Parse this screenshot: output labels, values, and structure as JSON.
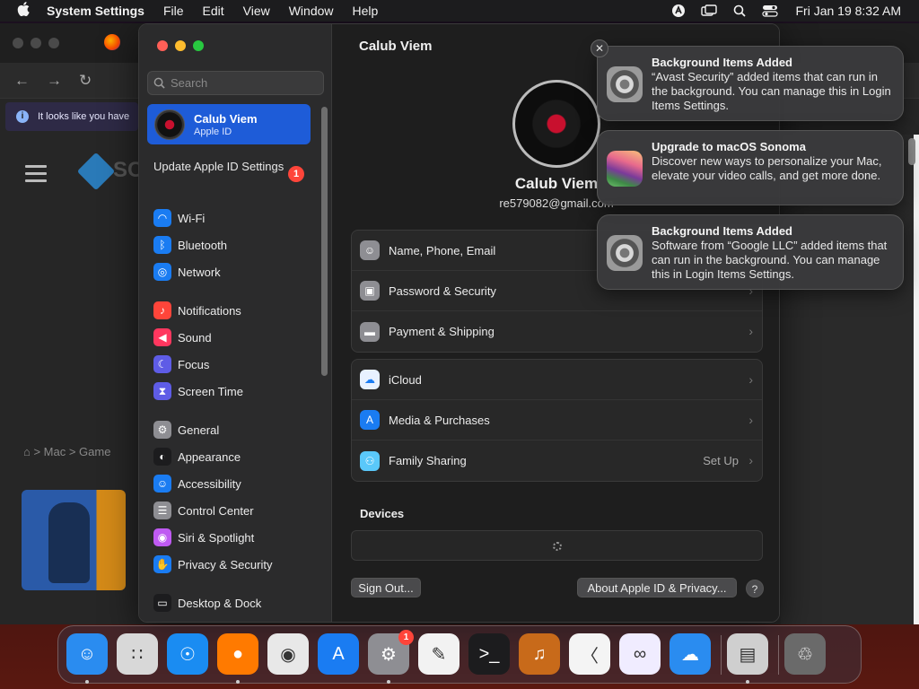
{
  "menubar": {
    "app_name": "System Settings",
    "items": [
      "File",
      "Edit",
      "View",
      "Window",
      "Help"
    ],
    "status_icons": [
      "avast-icon",
      "display-mirror-icon",
      "spotlight-search-icon",
      "control-center-icon"
    ],
    "clock": "Fri Jan 19  8:32 AM"
  },
  "browser": {
    "info_text": "It looks like you have",
    "logo_text": "SC",
    "breadcrumb": "⌂ > Mac > Game"
  },
  "settings": {
    "search": {
      "placeholder": "Search"
    },
    "account": {
      "name": "Calub Viem",
      "subtitle": "Apple ID"
    },
    "update": {
      "label": "Update Apple ID Settings",
      "badge": "1"
    },
    "sidebar_groups": [
      [
        {
          "label": "Wi-Fi",
          "icon": "wifi-icon",
          "color": "#1a7cf2"
        },
        {
          "label": "Bluetooth",
          "icon": "bluetooth-icon",
          "color": "#1a7cf2"
        },
        {
          "label": "Network",
          "icon": "globe-icon",
          "color": "#1a7cf2"
        }
      ],
      [
        {
          "label": "Notifications",
          "icon": "bell-icon",
          "color": "#ff453a"
        },
        {
          "label": "Sound",
          "icon": "speaker-icon",
          "color": "#ff375f"
        },
        {
          "label": "Focus",
          "icon": "moon-icon",
          "color": "#5e5ce6"
        },
        {
          "label": "Screen Time",
          "icon": "hourglass-icon",
          "color": "#5e5ce6"
        }
      ],
      [
        {
          "label": "General",
          "icon": "gear-icon",
          "color": "#8e8e93"
        },
        {
          "label": "Appearance",
          "icon": "appearance-icon",
          "color": "#1c1c1e"
        },
        {
          "label": "Accessibility",
          "icon": "accessibility-icon",
          "color": "#1a7cf2"
        },
        {
          "label": "Control Center",
          "icon": "control-center-icon",
          "color": "#8e8e93"
        },
        {
          "label": "Siri & Spotlight",
          "icon": "siri-icon",
          "color": "#bf5af2"
        },
        {
          "label": "Privacy & Security",
          "icon": "hand-icon",
          "color": "#1a7cf2"
        }
      ],
      [
        {
          "label": "Desktop & Dock",
          "icon": "dock-icon",
          "color": "#1c1c1e"
        }
      ]
    ],
    "content": {
      "title": "Calub Viem",
      "name": "Calub Viem",
      "email": "re579082@gmail.com",
      "card1": [
        {
          "label": "Name, Phone, Email",
          "icon": "person-icon",
          "color": "#8e8e93"
        },
        {
          "label": "Password & Security",
          "icon": "lock-icon",
          "color": "#8e8e93"
        },
        {
          "label": "Payment & Shipping",
          "icon": "creditcard-icon",
          "color": "#8e8e93"
        }
      ],
      "card2": [
        {
          "label": "iCloud",
          "icon": "cloud-icon",
          "color": "#e8f1ff",
          "value": ""
        },
        {
          "label": "Media & Purchases",
          "icon": "appstore-icon",
          "color": "#1a7cf2",
          "value": ""
        },
        {
          "label": "Family Sharing",
          "icon": "family-icon",
          "color": "#5ac8fa",
          "value": "Set Up"
        }
      ],
      "devices_title": "Devices",
      "sign_out": "Sign Out...",
      "about": "About Apple ID & Privacy...",
      "help": "?"
    }
  },
  "notifications": [
    {
      "title": "Background Items Added",
      "body": "“Avast Security” added items that can run in the background. You can manage this in Login Items Settings.",
      "icon": "gear-icon"
    },
    {
      "title": "Upgrade to macOS Sonoma",
      "body": "Discover new ways to personalize your Mac, elevate your video calls, and get more done.",
      "icon": "sonoma-icon"
    },
    {
      "title": "Background Items Added",
      "body": "Software from “Google LLC” added items that can run in the background. You can manage this in Login Items Settings.",
      "icon": "gear-icon"
    }
  ],
  "dock": {
    "apps": [
      {
        "name": "finder-icon",
        "color": "#2a8cf0",
        "running": true
      },
      {
        "name": "launchpad-icon",
        "color": "#d8d8d8",
        "running": false
      },
      {
        "name": "safari-icon",
        "color": "#1a8cf2",
        "running": false
      },
      {
        "name": "firefox-icon",
        "color": "#ff7a00",
        "running": true
      },
      {
        "name": "chrome-icon",
        "color": "#e8e8e8",
        "running": false
      },
      {
        "name": "app-store-icon",
        "color": "#1a7cf2",
        "running": false
      },
      {
        "name": "system-settings-icon",
        "color": "#8e8e93",
        "running": true,
        "badge": "1"
      },
      {
        "name": "textedit-icon",
        "color": "#f2f2f2",
        "running": false
      },
      {
        "name": "terminal-icon",
        "color": "#1c1c1e",
        "running": false
      },
      {
        "name": "garageband-icon",
        "color": "#c86a1a",
        "running": false
      },
      {
        "name": "vscode-icon",
        "color": "#f4f4f4",
        "running": false
      },
      {
        "name": "visual-studio-icon",
        "color": "#f0ecff",
        "running": false
      },
      {
        "name": "weather-icon",
        "color": "#2a8cf0",
        "running": false
      },
      {
        "name": "installer-icon",
        "color": "#cfcfcf",
        "running": true
      },
      {
        "name": "trash-icon",
        "color": "#6a6a6a",
        "running": false
      }
    ]
  }
}
